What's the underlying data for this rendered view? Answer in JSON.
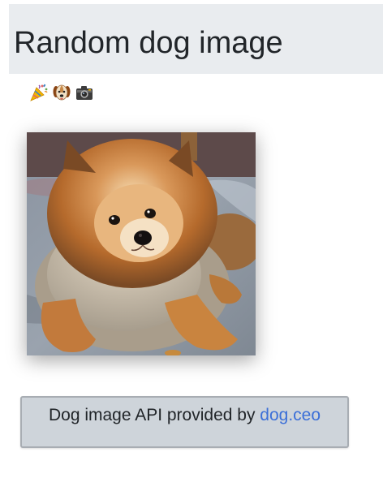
{
  "header": {
    "title": "Random dog image"
  },
  "icons": [
    {
      "name": "party-popper-icon"
    },
    {
      "name": "dog-face-icon"
    },
    {
      "name": "camera-icon"
    }
  ],
  "photo": {
    "subject": "pomeranian-dog"
  },
  "footer": {
    "prefix": "Dog image API provided by ",
    "link_text": "dog.ceo"
  },
  "colors": {
    "header_bg": "#e9ecef",
    "card_bg": "#ced4da",
    "link": "#3b6fd8",
    "text": "#212529"
  }
}
